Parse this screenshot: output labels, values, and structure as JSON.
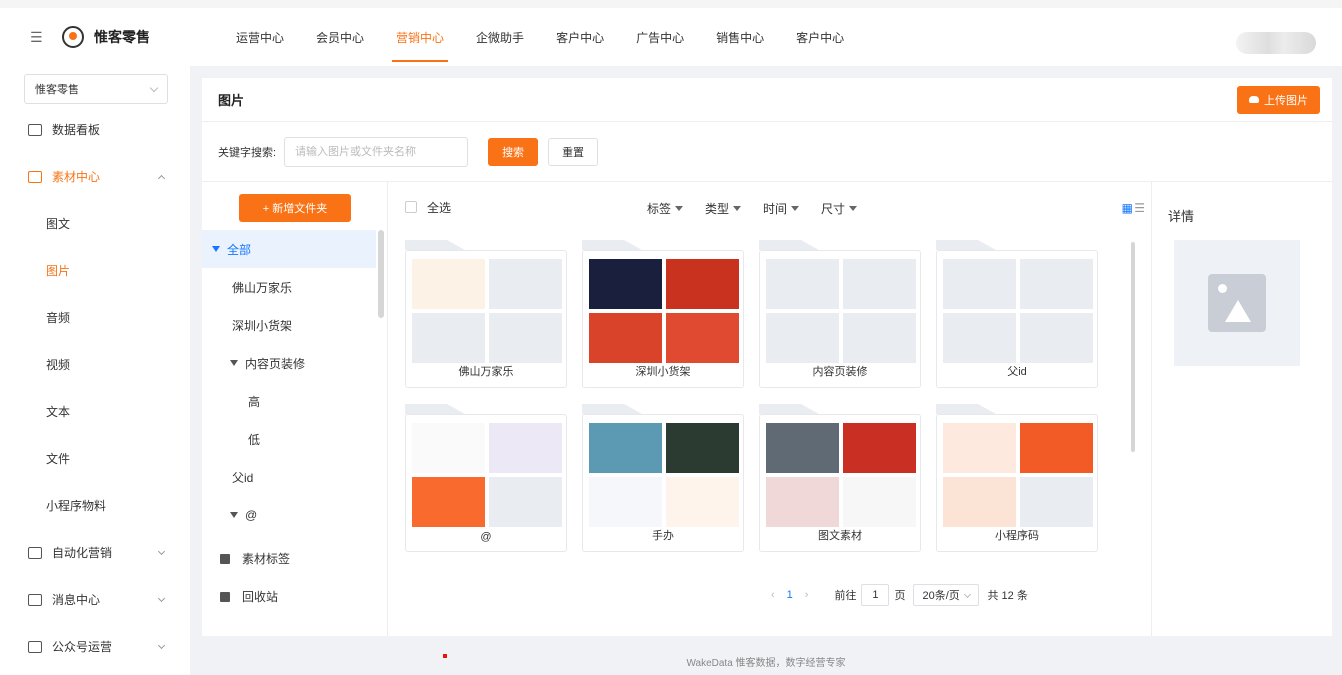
{
  "app": {
    "brand": "惟客零售",
    "footer": "WakeData 惟客数据，数字经营专家"
  },
  "nav": {
    "items": [
      "运营中心",
      "会员中心",
      "营销中心",
      "企微助手",
      "客户中心",
      "广告中心",
      "销售中心",
      "客户中心"
    ],
    "active_index": 2
  },
  "sidebar": {
    "store_select": "惟客零售",
    "dashboard": "数据看板",
    "material_center": "素材中心",
    "material_items": [
      "图文",
      "图片",
      "音频",
      "视频",
      "文本",
      "文件",
      "小程序物料"
    ],
    "active_sub": "图片",
    "automation": "自动化营销",
    "message_center": "消息中心",
    "official_account": "公众号运营"
  },
  "main": {
    "title": "图片",
    "upload_label": "上传图片",
    "search_label": "关键字搜索:",
    "search_placeholder": "请输入图片或文件夹名称",
    "search_button": "搜索",
    "reset_button": "重置"
  },
  "tree": {
    "new_folder_label": "+ 新增文件夹",
    "nodes": [
      {
        "label": "全部"
      },
      {
        "label": "佛山万家乐"
      },
      {
        "label": "深圳小货架"
      },
      {
        "label": "内容页装修"
      },
      {
        "label": "高"
      },
      {
        "label": "低"
      },
      {
        "label": "父id"
      },
      {
        "label": "@"
      }
    ],
    "material_tags": "素材标签",
    "recycle_bin": "回收站"
  },
  "grid": {
    "select_all": "全选",
    "filters": [
      "标签",
      "类型",
      "时间",
      "尺寸"
    ],
    "folders": [
      "佛山万家乐",
      "深圳小货架",
      "内容页装修",
      "父id",
      "@",
      "手办",
      "图文素材",
      "小程序码"
    ]
  },
  "pager": {
    "current": "1",
    "goto_label": "前往",
    "goto_value": "1",
    "page_unit": "页",
    "page_size": "20条/页",
    "total": "共 12 条"
  },
  "detail": {
    "title": "详情"
  },
  "colors": {
    "accent": "#f97316",
    "link": "#1677ff"
  },
  "icons": {
    "menu_fold": "menu-fold-icon",
    "logo": "logo-icon",
    "upload": "cloud-upload-icon",
    "grid_view": "grid-view-icon",
    "list_view": "list-view-icon",
    "image_placeholder": "image-icon",
    "tag": "tag-icon",
    "trash": "trash-icon"
  }
}
